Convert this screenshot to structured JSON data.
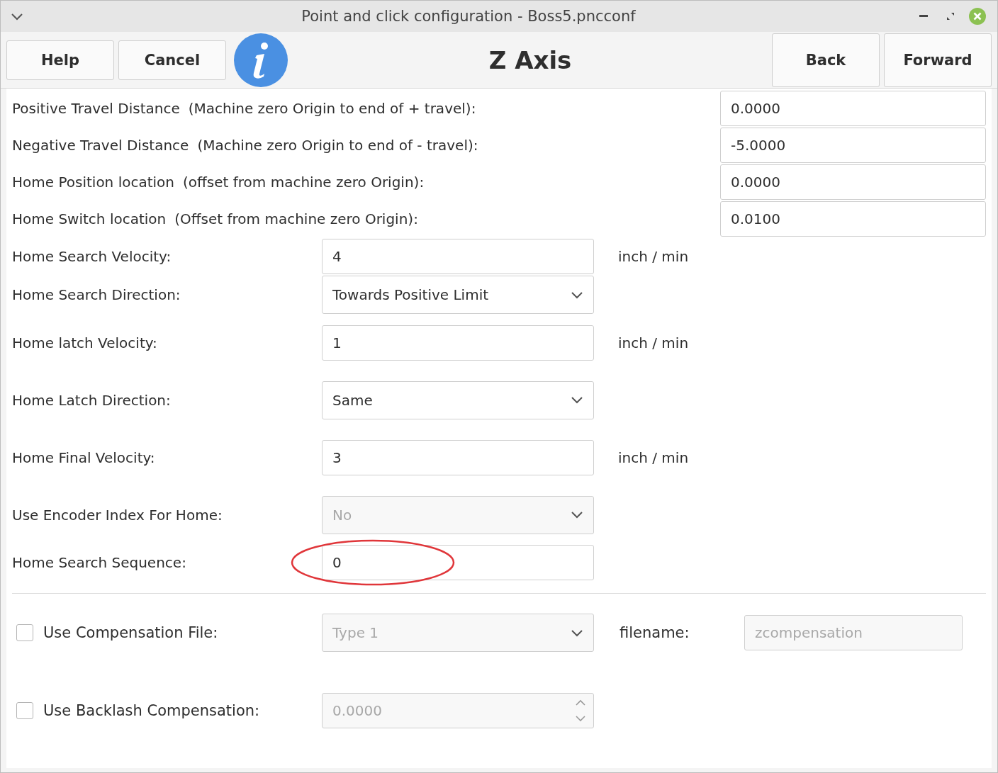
{
  "window": {
    "title": "Point and click configuration - Boss5.pncconf"
  },
  "toolbar": {
    "left_buttons": [
      "Help",
      "Cancel"
    ],
    "heading": "Z Axis",
    "right_buttons": [
      "Back",
      "Forward"
    ]
  },
  "travel_rows": [
    {
      "label": "Positive Travel Distance",
      "note": "(Machine zero Origin to end of + travel):",
      "value": "0.0000"
    },
    {
      "label": "Negative Travel Distance",
      "note": "(Machine zero Origin to end of - travel):",
      "value": "-5.0000"
    },
    {
      "label": "Home Position location",
      "note": "(offset from machine zero Origin):",
      "value": "0.0000"
    },
    {
      "label": "Home Switch location",
      "note": "(Offset from machine zero Origin):",
      "value": "0.0100"
    }
  ],
  "home_rows": [
    {
      "kind": "entry",
      "label": "Home Search Velocity:",
      "value": "4",
      "unit": "inch / min",
      "disabled": false,
      "circled": false
    },
    {
      "kind": "dropdown",
      "label": "Home Search Direction:",
      "value": "Towards Positive Limit",
      "disabled": false,
      "circled": false
    },
    {
      "kind": "entry",
      "label": "Home latch Velocity:",
      "value": "1",
      "unit": "inch / min",
      "disabled": false,
      "circled": false
    },
    {
      "kind": "dropdown",
      "label": "Home Latch Direction:",
      "value": "Same",
      "disabled": false,
      "circled": false
    },
    {
      "kind": "entry",
      "label": "Home Final Velocity:",
      "value": "3",
      "unit": "inch / min",
      "disabled": false,
      "circled": false
    },
    {
      "kind": "dropdown",
      "label": "Use Encoder Index For Home:",
      "value": "No",
      "disabled": true,
      "circled": false
    },
    {
      "kind": "entry",
      "label": "Home Search Sequence:",
      "value": "0",
      "disabled": false,
      "circled": true
    }
  ],
  "compensation_rows": [
    {
      "kind": "file",
      "checked": false,
      "label": "Use Compensation File:",
      "value": "Type 1",
      "disabled": true,
      "filename_label": "filename:",
      "filename": "zcompensation"
    },
    {
      "kind": "spin",
      "checked": false,
      "label": "Use Backlash Compensation:",
      "value": "0.0000",
      "disabled": true
    }
  ]
}
